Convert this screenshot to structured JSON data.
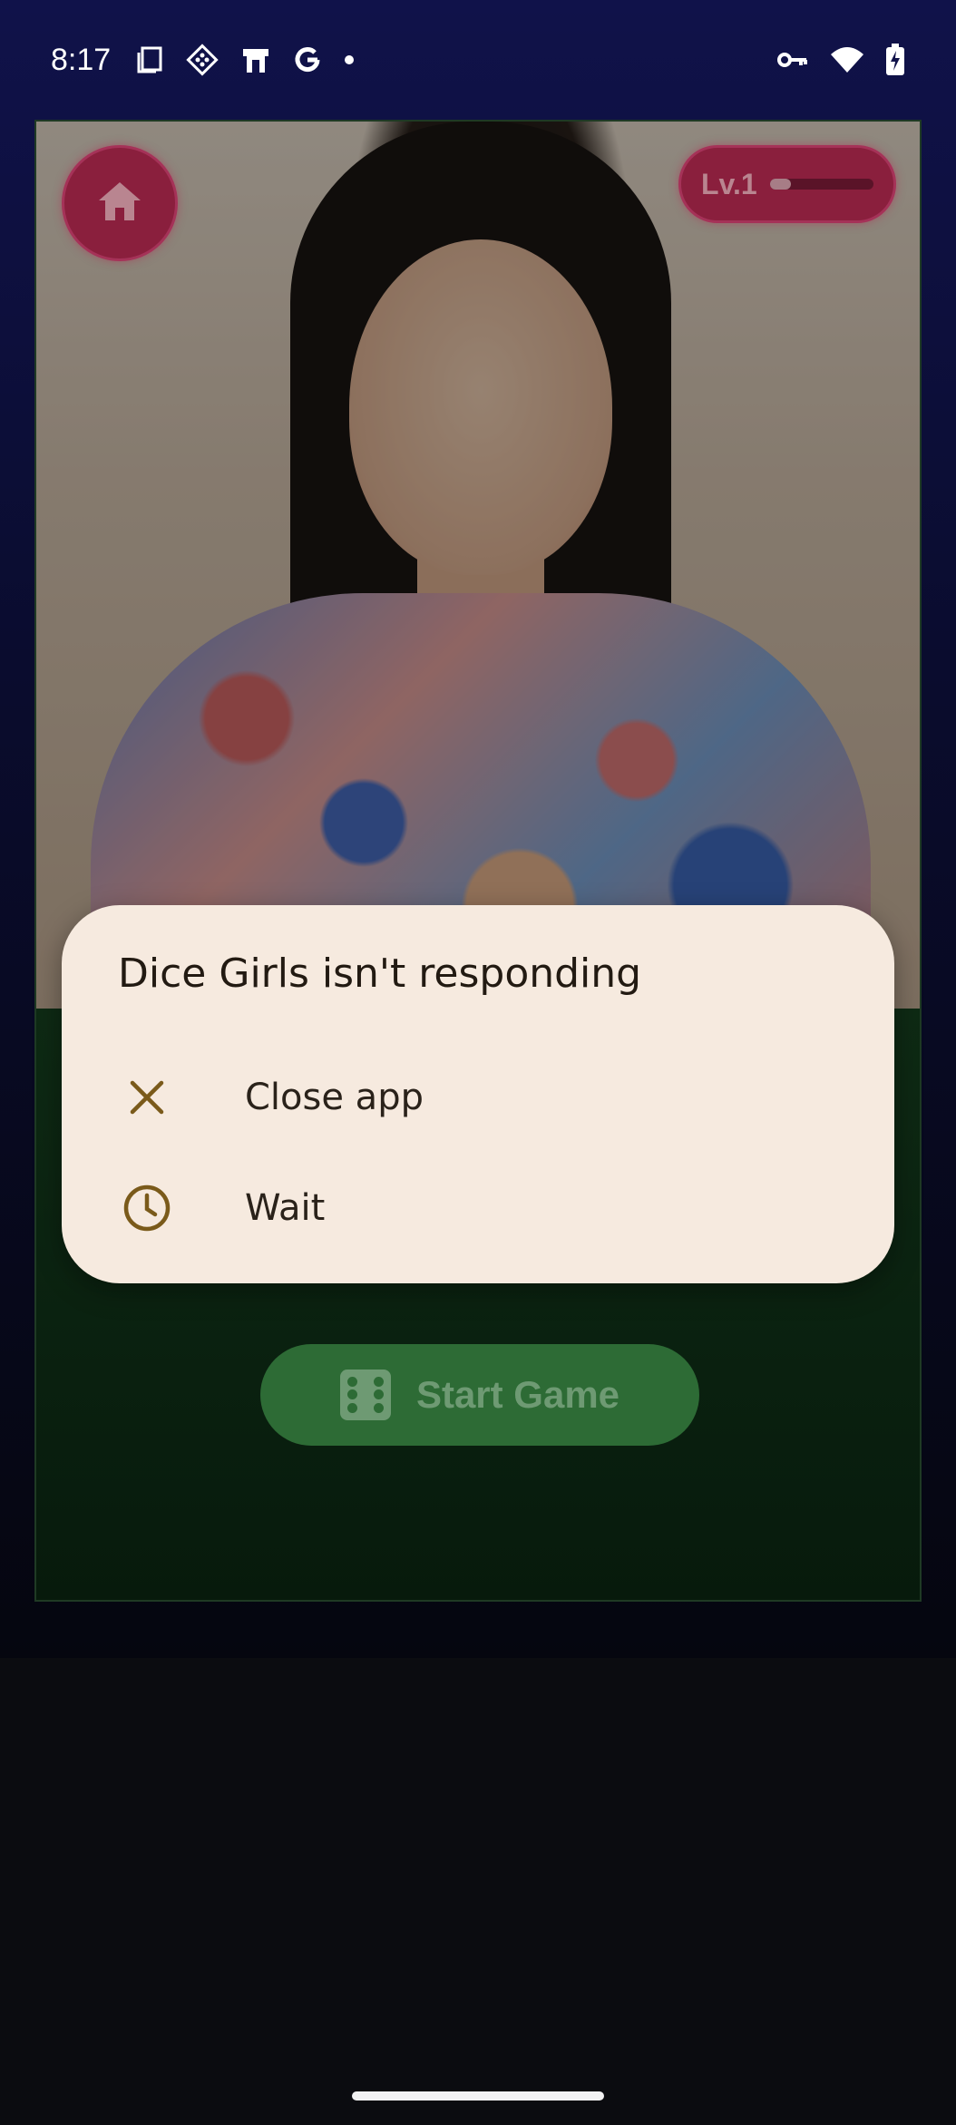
{
  "status_bar": {
    "time": "8:17",
    "icons_left": [
      "screenshot-icon",
      "app-icon",
      "store-icon",
      "google-icon",
      "dot-icon"
    ],
    "icons_right": [
      "vpn-key-icon",
      "wifi-icon",
      "battery-charging-icon"
    ]
  },
  "game": {
    "level_label": "Lv.1",
    "level_progress": 0.2,
    "start_label": "Start Game"
  },
  "dialog": {
    "title": "Dice Girls isn't responding",
    "options": [
      {
        "label": "Close app",
        "icon": "close-icon"
      },
      {
        "label": "Wait",
        "icon": "clock-icon"
      }
    ]
  },
  "colors": {
    "dialog_bg": "#f6eadf",
    "dialog_icon": "#7a5a1a",
    "accent_pink": "#8a1f3d",
    "start_green": "#2d6b35"
  }
}
